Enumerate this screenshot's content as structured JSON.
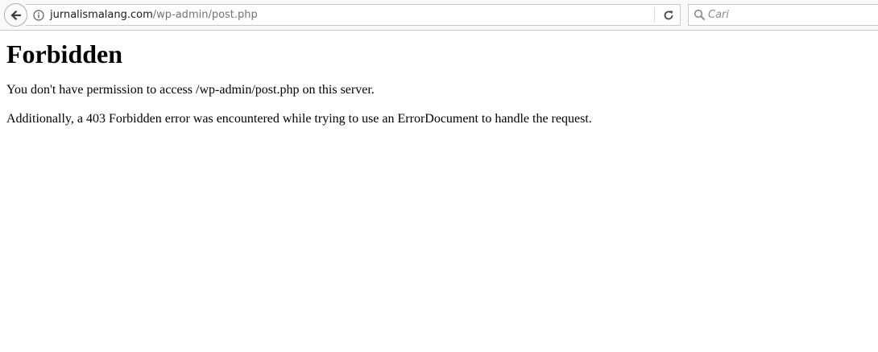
{
  "browser": {
    "url_domain": "jurnalismalang.com",
    "url_path": "/wp-admin/post.php",
    "search_placeholder": "Cari",
    "icons": {
      "back": "back-arrow-icon",
      "info": "info-icon",
      "reload": "reload-icon",
      "search": "search-icon"
    }
  },
  "page": {
    "heading": "Forbidden",
    "paragraph_1": "You don't have permission to access /wp-admin/post.php on this server.",
    "paragraph_2": "Additionally, a 403 Forbidden error was encountered while trying to use an ErrorDocument to handle the request."
  }
}
